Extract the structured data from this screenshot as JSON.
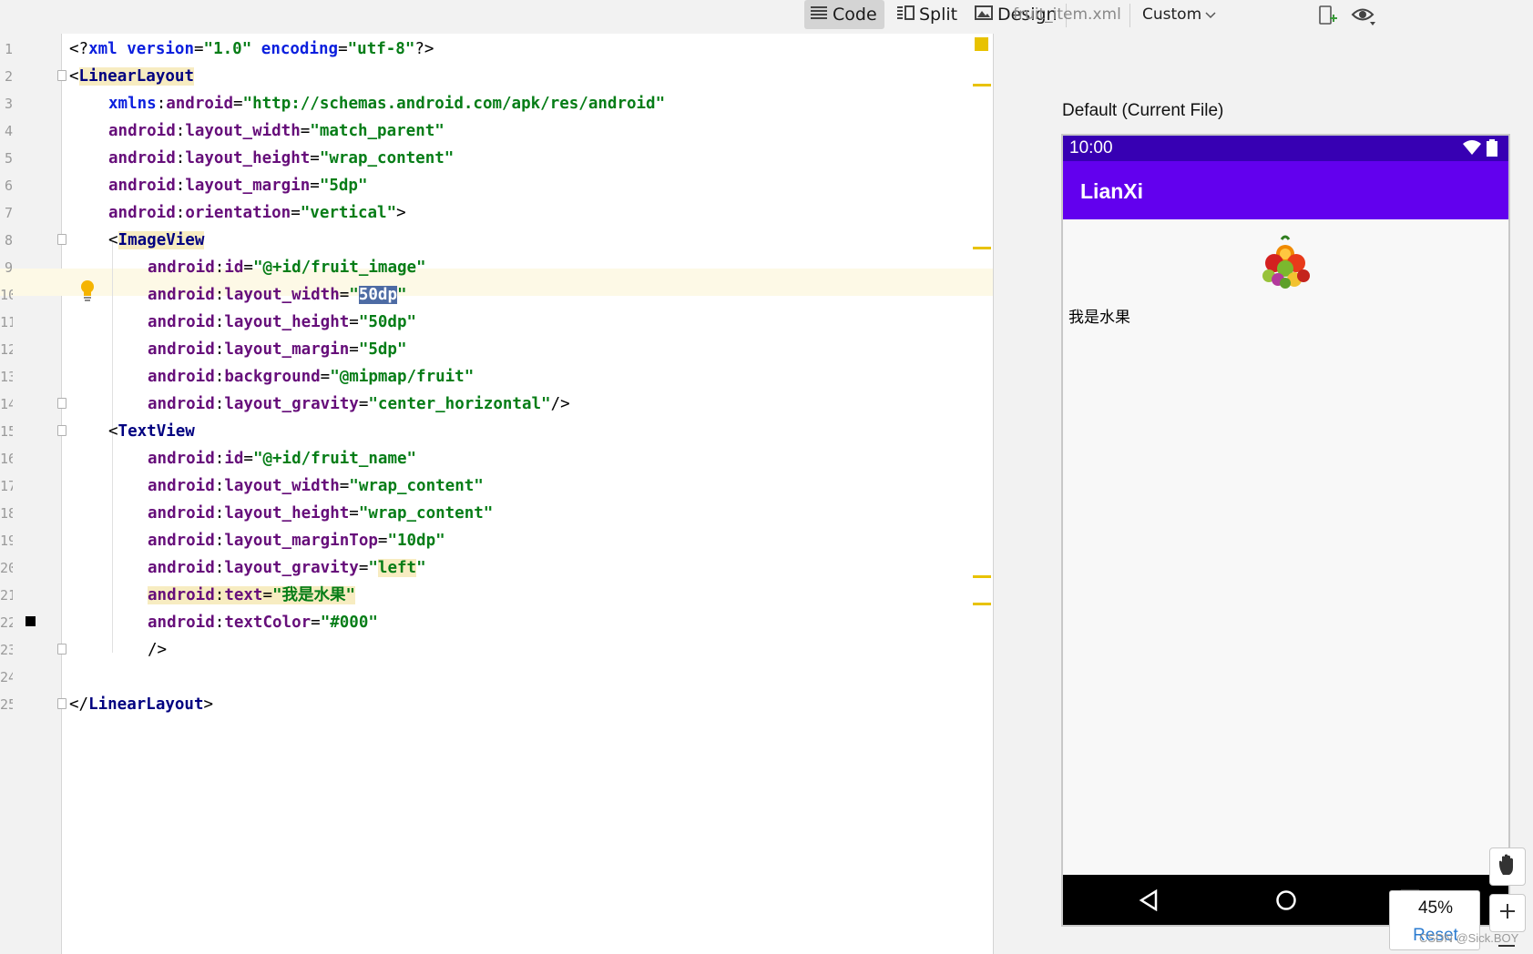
{
  "toolbar": {
    "code_label": "Code",
    "split_label": "Split",
    "design_label": "Design",
    "filename": "fruit_item.xml",
    "device_config": "Custom"
  },
  "editor": {
    "line_numbers": [
      "1",
      "2",
      "3",
      "4",
      "5",
      "6",
      "7",
      "8",
      "9",
      "10",
      "11",
      "12",
      "13",
      "14",
      "15",
      "16",
      "17",
      "18",
      "19",
      "20",
      "21",
      "22",
      "23",
      "24",
      "25"
    ],
    "current_line": "10",
    "lines": {
      "l1_open": "<?",
      "l1_tag": "xml",
      "l1_attr1": "version",
      "l1_val1": "\"1.0\"",
      "l1_attr2": "encoding",
      "l1_val2": "\"utf-8\"",
      "l1_close": "?>",
      "l2_tag": "LinearLayout",
      "l3_ns": "xmlns",
      "l3_attr": "android",
      "l3_val": "\"http://schemas.android.com/apk/res/android\"",
      "l4_ns": "android",
      "l4_attr": "layout_width",
      "l4_val": "\"match_parent\"",
      "l5_ns": "android",
      "l5_attr": "layout_height",
      "l5_val": "\"wrap_content\"",
      "l6_ns": "android",
      "l6_attr": "layout_margin",
      "l6_val": "\"5dp\"",
      "l7_ns": "android",
      "l7_attr": "orientation",
      "l7_val": "\"vertical\"",
      "l8_tag": "ImageView",
      "l9_ns": "android",
      "l9_attr": "id",
      "l9_val": "\"@+id/fruit_image\"",
      "l10_ns": "android",
      "l10_attr": "layout_width",
      "l10_sel": "50dp",
      "l11_ns": "android",
      "l11_attr": "layout_height",
      "l11_val": "\"50dp\"",
      "l12_ns": "android",
      "l12_attr": "layout_margin",
      "l12_val": "\"5dp\"",
      "l13_ns": "android",
      "l13_attr": "background",
      "l13_val": "\"@mipmap/fruit\"",
      "l14_ns": "android",
      "l14_attr": "layout_gravity",
      "l14_val": "\"center_horizontal\"",
      "l15_tag": "TextView",
      "l16_ns": "android",
      "l16_attr": "id",
      "l16_val": "\"@+id/fruit_name\"",
      "l17_ns": "android",
      "l17_attr": "layout_width",
      "l17_val": "\"wrap_content\"",
      "l18_ns": "android",
      "l18_attr": "layout_height",
      "l18_val": "\"wrap_content\"",
      "l19_ns": "android",
      "l19_attr": "layout_marginTop",
      "l19_val": "\"10dp\"",
      "l20_ns": "android",
      "l20_attr": "layout_gravity",
      "l20_val": "left",
      "l21_ns": "android",
      "l21_attr": "text",
      "l21_val": "\"我是水果\"",
      "l22_ns": "android",
      "l22_attr": "textColor",
      "l22_val": "\"#000\"",
      "l23_close": "/>",
      "l25_tag": "LinearLayout"
    }
  },
  "preview": {
    "label": "Default (Current File)",
    "status_time": "10:00",
    "app_title": "LianXi",
    "fruit_text": "我是水果"
  },
  "zoom": {
    "value": "45%",
    "reset_label": "Reset"
  },
  "watermark": "CSDN @Sick.BOY",
  "colors": {
    "status_bar": "#3700b3",
    "app_bar": "#6200ee",
    "xml_tag": "#000080",
    "xml_attr": "#660e7a",
    "xml_value": "#067d17",
    "selection": "#4d6ba4",
    "marker": "#e8c200"
  }
}
